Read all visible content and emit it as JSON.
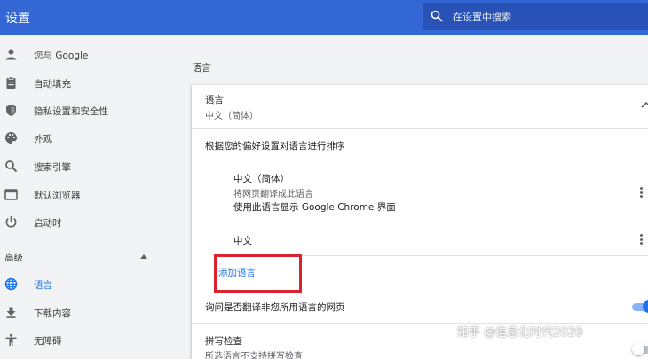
{
  "header": {
    "title": "设置",
    "search_placeholder": "在设置中搜索",
    "color": "#3367d6"
  },
  "sidebar": {
    "items": [
      {
        "label": "您与 Google",
        "icon": "person-icon"
      },
      {
        "label": "自动填充",
        "icon": "clipboard-icon"
      },
      {
        "label": "隐私设置和安全性",
        "icon": "shield-icon"
      },
      {
        "label": "外观",
        "icon": "palette-icon"
      },
      {
        "label": "搜索引擎",
        "icon": "search-icon"
      },
      {
        "label": "默认浏览器",
        "icon": "browser-icon"
      },
      {
        "label": "启动时",
        "icon": "power-icon"
      }
    ],
    "advanced_label": "高级",
    "advanced_items": [
      {
        "label": "语言",
        "icon": "globe-icon",
        "active": true
      },
      {
        "label": "下载内容",
        "icon": "download-icon"
      },
      {
        "label": "无障碍",
        "icon": "accessibility-icon"
      }
    ]
  },
  "main": {
    "section_title": "语言",
    "language_header": {
      "label": "语言",
      "value": "中文（简体）"
    },
    "order_description": "根据您的偏好设置对语言进行排序",
    "languages": [
      {
        "name": "中文（简体）",
        "lines": [
          "将网页翻译成此语言",
          "使用此语言显示 Google Chrome 界面"
        ]
      },
      {
        "name": "中文",
        "lines": []
      }
    ],
    "add_language_label": "添加语言",
    "translate_offer": {
      "label": "询问是否翻译非您所用语言的网页",
      "enabled": true
    },
    "spellcheck": {
      "label": "拼写检查",
      "description": "所选语言不支持拼写检查",
      "enabled": false
    }
  },
  "watermark": "知乎 @信息化时代2020",
  "highlight_color": "#d9232e"
}
